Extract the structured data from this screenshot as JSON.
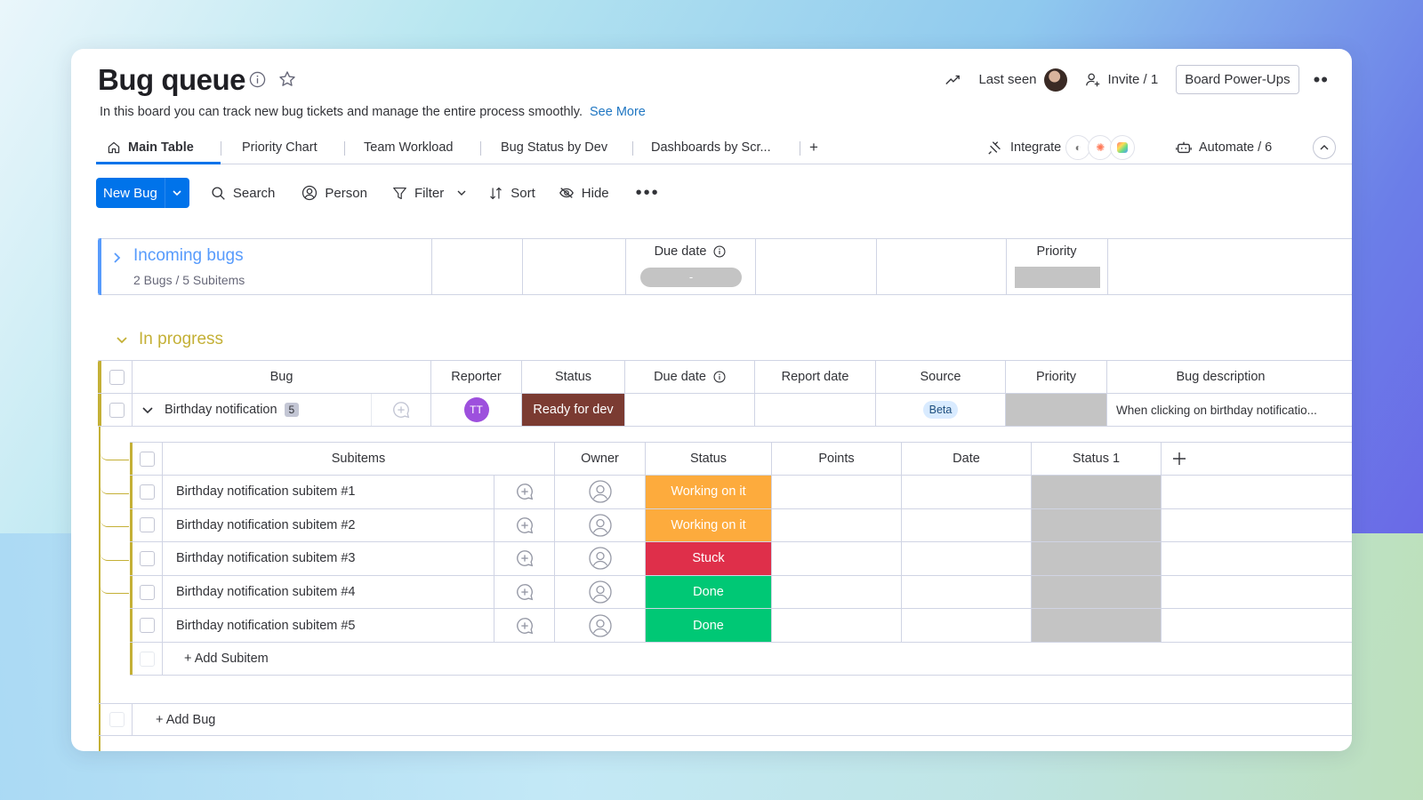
{
  "board": {
    "title": "Bug queue",
    "description": "In this board you can track new bug tickets and manage the entire process smoothly.",
    "see_more": "See More"
  },
  "header": {
    "last_seen": "Last seen",
    "invite": "Invite / 1",
    "power_ups": "Board Power-Ups"
  },
  "tabs": [
    {
      "label": "Main Table",
      "active": true
    },
    {
      "label": "Priority Chart"
    },
    {
      "label": "Team Workload"
    },
    {
      "label": "Bug Status by Dev"
    },
    {
      "label": "Dashboards by Scr..."
    }
  ],
  "tab_add": "+",
  "integrate": "Integrate",
  "automate": "Automate / 6",
  "toolbar": {
    "new_bug": "New Bug",
    "search": "Search",
    "person": "Person",
    "filter": "Filter",
    "sort": "Sort",
    "hide": "Hide"
  },
  "group_incoming": {
    "title": "Incoming bugs",
    "summary": "2 Bugs / 5 Subitems",
    "due_date_header": "Due date",
    "due_date_value": "-",
    "priority_header": "Priority",
    "color": "#579bfc"
  },
  "group_progress": {
    "title": "In progress",
    "color": "#c4b036",
    "columns": [
      "Bug",
      "Reporter",
      "Status",
      "Due date",
      "Report date",
      "Source",
      "Priority",
      "Bug description"
    ],
    "item": {
      "name": "Birthday notification",
      "subitem_count": "5",
      "reporter_initials": "TT",
      "status": "Ready for dev",
      "status_color": "#7b3b32",
      "source": "Beta",
      "description": "When clicking on birthday notificatio..."
    },
    "sub_columns": [
      "Subitems",
      "Owner",
      "Status",
      "Points",
      "Date",
      "Status 1"
    ],
    "subitems": [
      {
        "name": "Birthday notification subitem #1",
        "status": "Working on it",
        "color": "#fdab3d"
      },
      {
        "name": "Birthday notification subitem #2",
        "status": "Working on it",
        "color": "#fdab3d"
      },
      {
        "name": "Birthday notification subitem #3",
        "status": "Stuck",
        "color": "#df2f4a"
      },
      {
        "name": "Birthday notification subitem #4",
        "status": "Done",
        "color": "#00c875"
      },
      {
        "name": "Birthday notification subitem #5",
        "status": "Done",
        "color": "#00c875"
      }
    ],
    "add_subitem": "+ Add Subitem",
    "add_bug": "+ Add Bug"
  }
}
